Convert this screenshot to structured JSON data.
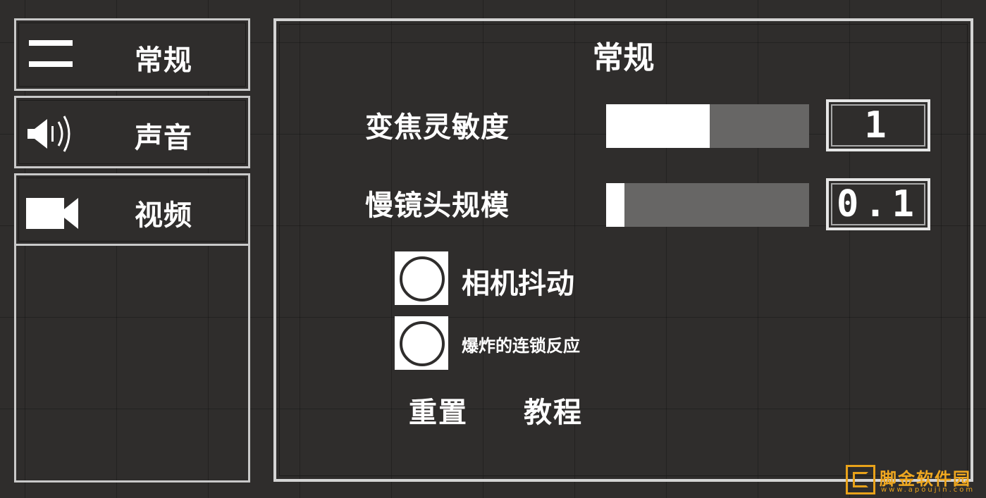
{
  "sidebar": {
    "items": [
      {
        "label": "常规",
        "icon": "menu-icon"
      },
      {
        "label": "声音",
        "icon": "speaker-icon"
      },
      {
        "label": "视频",
        "icon": "video-camera-icon"
      }
    ]
  },
  "panel": {
    "title": "常规",
    "settings": [
      {
        "label": "变焦灵敏度",
        "slider_fraction": 0.51,
        "value": "1"
      },
      {
        "label": "慢镜头规模",
        "slider_fraction": 0.09,
        "value": "0.1"
      }
    ],
    "toggles": [
      {
        "label": "相机抖动",
        "checked": false
      },
      {
        "label": "爆炸的连锁反应",
        "checked": false
      }
    ],
    "buttons": {
      "reset": "重置",
      "tutorial": "教程"
    }
  },
  "watermark": {
    "text": "脚金软件园",
    "url": "www.apoujin.com"
  },
  "colors": {
    "background": "#2f2d2c",
    "border": "#c9c9c9",
    "slider_track": "#676665",
    "slider_fill": "#ffffff",
    "watermark": "#e8a21a"
  }
}
